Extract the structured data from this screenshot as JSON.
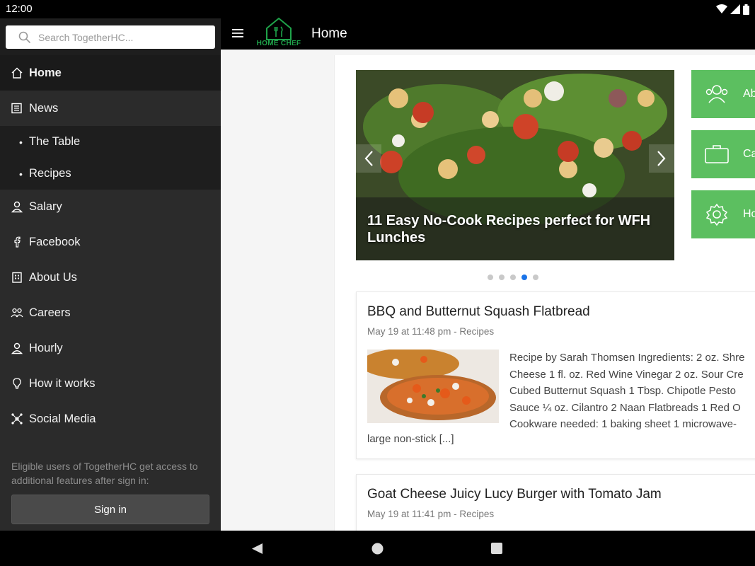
{
  "status": {
    "time": "12:00"
  },
  "search": {
    "placeholder": "Search TogetherHC..."
  },
  "sidebar": {
    "items": [
      {
        "label": "Home"
      },
      {
        "label": "News"
      },
      {
        "label": "The Table"
      },
      {
        "label": "Recipes"
      },
      {
        "label": "Salary"
      },
      {
        "label": "Facebook"
      },
      {
        "label": "About Us"
      },
      {
        "label": "Careers"
      },
      {
        "label": "Hourly"
      },
      {
        "label": "How it works"
      },
      {
        "label": "Social Media"
      }
    ],
    "signin_note": "Eligible users of TogetherHC get access to additional features after sign in:",
    "signin_label": "Sign in"
  },
  "appbar": {
    "title": "Home",
    "logo_text": "HOME CHEF"
  },
  "carousel": {
    "caption": "11 Easy No-Cook Recipes perfect for WFH Lunches",
    "total_slides": 5,
    "active_slide": 4
  },
  "quick_actions": [
    {
      "label": "Ab",
      "icon": "people-icon"
    },
    {
      "label": "Ca",
      "icon": "briefcase-icon"
    },
    {
      "label": "Ho",
      "icon": "gear-icon"
    }
  ],
  "posts": [
    {
      "title": "BBQ and Butternut Squash Flatbread",
      "meta": "May 19 at 11:48 pm - Recipes",
      "excerpt_lines": [
        "Recipe by Sarah Thomsen Ingredients: 2 oz. Shre",
        "Cheese 1 fl. oz. Red Wine Vinegar 2 oz. Sour Cre",
        "Cubed Butternut Squash 1 Tbsp. Chipotle Pesto",
        "Sauce ¼ oz. Cilantro 2 Naan Flatbreads 1 Red O",
        "Cookware needed: 1 baking sheet 1 microwave-"
      ],
      "excerpt_tail": "large non-stick [...]"
    },
    {
      "title": "Goat Cheese Juicy Lucy Burger with Tomato Jam",
      "meta": "May 19 at 11:41 pm - Recipes"
    }
  ],
  "colors": {
    "accent_green": "#5cbf60",
    "logo_green": "#1fa34a",
    "dot_active": "#1a73e8"
  }
}
